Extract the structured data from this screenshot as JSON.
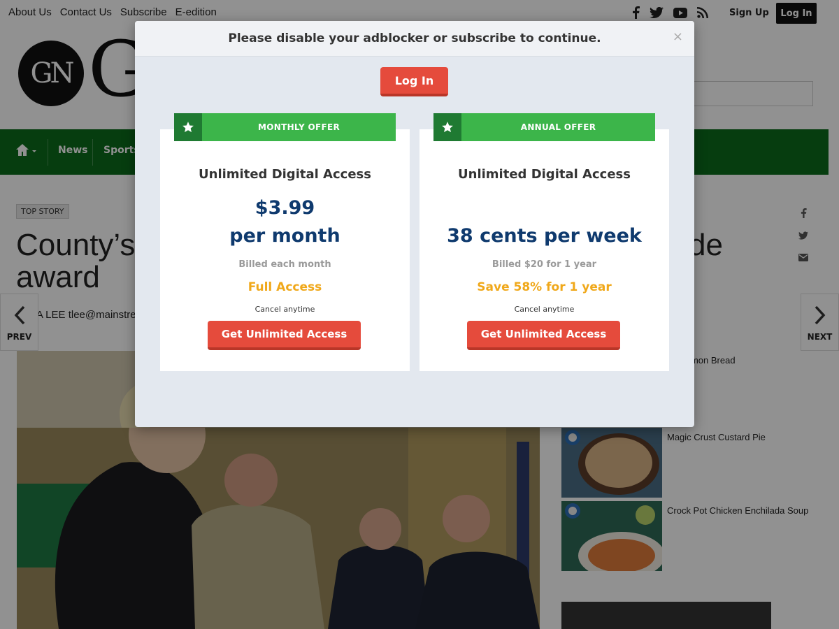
{
  "topbar": {
    "links": [
      "About Us",
      "Contact Us",
      "Subscribe",
      "E-edition"
    ],
    "social_icons": [
      "facebook-icon",
      "twitter-icon",
      "youtube-icon",
      "rss-icon"
    ],
    "signup_label": "Sign Up",
    "login_label": "Log In"
  },
  "masthead": {
    "logo_text": "GN",
    "logo_wordmark_fragment": "G"
  },
  "nav": {
    "home_icon": "home-icon",
    "items": [
      "News",
      "Sports"
    ]
  },
  "article": {
    "tag": "TOP STORY",
    "headline_left": "County’s",
    "headline_right": "de",
    "headline_line2": "award",
    "byline": "ENA LEE tlee@mainstreet",
    "prev_label": "PREV",
    "next_label": "NEXT"
  },
  "sidebar": {
    "recipes": [
      {
        "title": "Cinnamon Bread"
      },
      {
        "title": "Magic Crust Custard Pie"
      },
      {
        "title": "Crock Pot Chicken Enchilada Soup"
      }
    ]
  },
  "modal": {
    "title": "Please disable your adblocker or subscribe to continue.",
    "close_glyph": "×",
    "login_label": "Log In",
    "offers": [
      {
        "banner": "MONTHLY OFFER",
        "heading": "Unlimited Digital Access",
        "price_line1": "$3.99",
        "price_line2": "per month",
        "billed": "Billed each month",
        "promo": "Full Access",
        "cancel": "Cancel anytime",
        "cta": "Get Unlimited Access"
      },
      {
        "banner": "ANNUAL OFFER",
        "heading": "Unlimited Digital Access",
        "price_line1": "",
        "price_line2": "38 cents per week",
        "billed": "Billed $20 for 1 year",
        "promo": "Save 58% for 1 year",
        "cancel": "Cancel anytime",
        "cta": "Get Unlimited Access"
      }
    ]
  },
  "colors": {
    "nav_green": "#0b6b1b",
    "banner_green": "#3cb54a",
    "cta_red": "#e54b3c",
    "price_blue": "#0f3a6e",
    "promo_orange": "#f0a81a"
  }
}
